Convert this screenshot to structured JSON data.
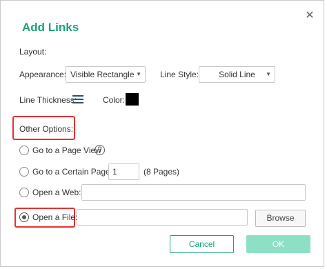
{
  "dialog": {
    "title": "Add Links",
    "close_icon": "close-icon"
  },
  "layout": {
    "section_label": "Layout:",
    "appearance_label": "Appearance:",
    "appearance_value": "Visible Rectangle",
    "line_style_label": "Line Style:",
    "line_style_value": "Solid Line",
    "line_thickness_label": "Line Thickness:",
    "line_thickness_icon": "line-thickness-icon",
    "color_label": "Color:",
    "color_value": "#000000"
  },
  "other_options": {
    "section_label": "Other Options:",
    "go_to_page_view_label": "Go to a Page View",
    "help_icon": "?",
    "go_to_certain_page_label": "Go to a Certain Page:",
    "page_number_value": "1",
    "page_count_text": "(8 Pages)",
    "open_web_label": "Open a Web:",
    "open_web_value": "",
    "open_file_label": "Open a File:",
    "open_file_value": "",
    "selected_option": "Open a File:"
  },
  "buttons": {
    "browse": "Browse",
    "cancel": "Cancel",
    "ok": "OK"
  },
  "colors": {
    "accent": "#1aa37a",
    "ok_disabled": "#8ee0c4",
    "highlight": "#e53030"
  }
}
